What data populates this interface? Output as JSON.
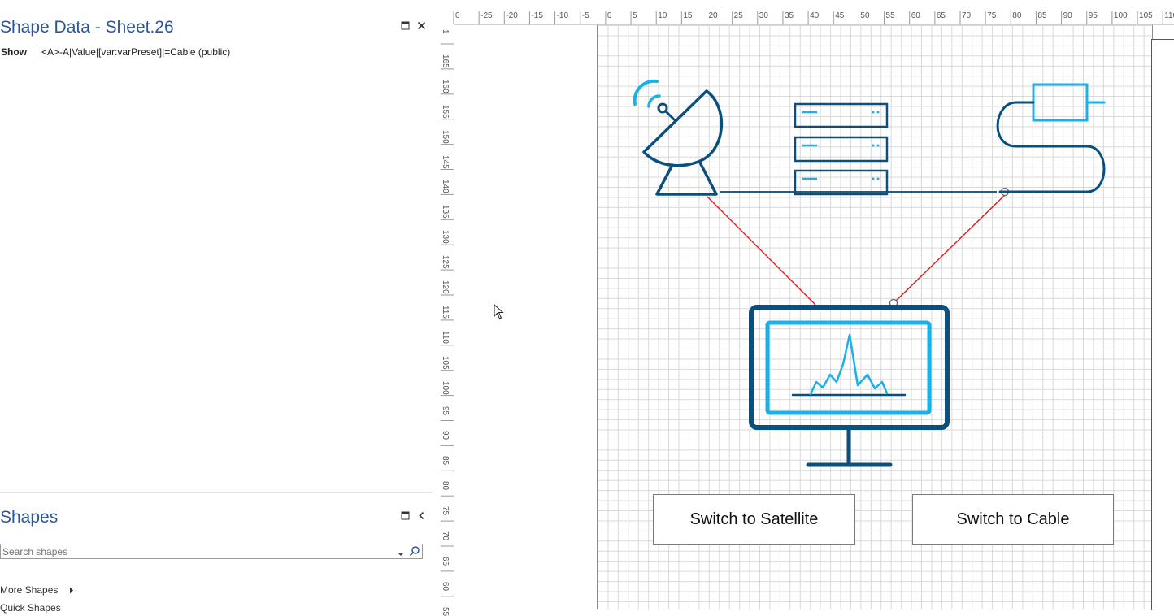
{
  "shape_data_pane": {
    "title": "Shape Data - Sheet.26",
    "show_label": "Show",
    "show_value": "<A>-A|Value|[var:varPreset]|=Cable (public)"
  },
  "shapes_pane": {
    "title": "Shapes",
    "search_placeholder": "Search shapes",
    "more_shapes": "More Shapes",
    "quick_shapes": "Quick Shapes"
  },
  "rulers": {
    "top_labels": [
      "0",
      "-25",
      "-20",
      "-15",
      "-10",
      "-5",
      "0",
      "5",
      "10",
      "15",
      "20",
      "25",
      "30",
      "35",
      "40",
      "45",
      "50",
      "55",
      "60",
      "65",
      "70",
      "75",
      "80",
      "85",
      "90",
      "95",
      "100",
      "105",
      "110"
    ],
    "left_labels": [
      "1",
      "165",
      "160",
      "155",
      "150",
      "145",
      "140",
      "135",
      "130",
      "125",
      "120",
      "115",
      "110",
      "105",
      "100",
      "95",
      "90",
      "85",
      "80",
      "75",
      "70",
      "65",
      "60",
      "55"
    ]
  },
  "diagram": {
    "button_satellite": "Switch to Satellite",
    "button_cable": "Switch to Cable",
    "colors": {
      "dark_blue": "#0b4f7c",
      "light_blue": "#1ab0e8",
      "connector_red": "#e02020",
      "connector_dark": "#1f5f85"
    }
  },
  "icons": [
    "restore-icon",
    "close-icon",
    "collapse-icon",
    "search-icon",
    "dropdown-icon",
    "arrow-right-icon",
    "mouse-cursor-icon",
    "satellite-dish-icon",
    "server-rack-icon",
    "cable-plug-icon",
    "monitor-chart-icon"
  ]
}
